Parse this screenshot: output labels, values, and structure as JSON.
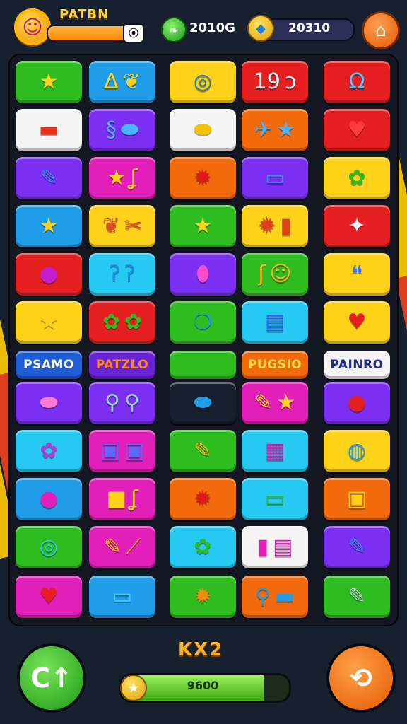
{
  "header": {
    "player_name": "PATBN",
    "xp_progress": 0.8,
    "xp_button": "⦿",
    "coins_value": "2010G",
    "gems_value": "20310",
    "icons": {
      "avatar": "face-avatar-icon",
      "coin": "leaf-coin-icon",
      "gem": "shield-gem-icon",
      "shop": "shop-icon"
    }
  },
  "colors": {
    "green": "#2ebd1f",
    "blue": "#1f9de8",
    "yellow": "#ffd21a",
    "red": "#e51f1f",
    "orange": "#f26a0c",
    "purple": "#7b2ff2",
    "magenta": "#e21fb8",
    "white": "#f4f4f4",
    "cyan": "#25c9f2"
  },
  "tiles": [
    {
      "bg": "#2ebd1f",
      "glyphs": [
        "★"
      ],
      "fg": "#ffd21a"
    },
    {
      "bg": "#1f9de8",
      "glyphs": [
        "ᐃ",
        "❦"
      ],
      "fg": "#ffd21a"
    },
    {
      "bg": "#ffd21a",
      "glyphs": [
        "◎"
      ],
      "fg": "#1e7fc2"
    },
    {
      "bg": "#e51f1f",
      "glyphs": [
        "19",
        "ↄ"
      ],
      "fg": "#ffffff"
    },
    {
      "bg": "#e51f1f",
      "glyphs": [
        "Ω"
      ],
      "fg": "#5ac8ff"
    },
    {
      "bg": "#f4f4f4",
      "glyphs": [
        "▬"
      ],
      "fg": "#e03018"
    },
    {
      "bg": "#7b2ff2",
      "glyphs": [
        "§",
        "⬬"
      ],
      "fg": "#4ab4ff"
    },
    {
      "bg": "#f4f4f4",
      "glyphs": [
        "⬬"
      ],
      "fg": "#f2c400"
    },
    {
      "bg": "#f26a0c",
      "glyphs": [
        "✈",
        "★"
      ],
      "fg": "#4ab4ff"
    },
    {
      "bg": "#e51f1f",
      "glyphs": [
        "♥"
      ],
      "fg": "#ff3a3a"
    },
    {
      "bg": "#7b2ff2",
      "glyphs": [
        "✎"
      ],
      "fg": "#3a8cff"
    },
    {
      "bg": "#e21fb8",
      "glyphs": [
        "★",
        "ʆ"
      ],
      "fg": "#ffd21a"
    },
    {
      "bg": "#f26a0c",
      "glyphs": [
        "✹"
      ],
      "fg": "#e01818"
    },
    {
      "bg": "#7b2ff2",
      "glyphs": [
        "▭"
      ],
      "fg": "#3a8cff"
    },
    {
      "bg": "#ffd21a",
      "glyphs": [
        "✿"
      ],
      "fg": "#2ebd1f"
    },
    {
      "bg": "#1f9de8",
      "glyphs": [
        "★"
      ],
      "fg": "#ffd21a"
    },
    {
      "bg": "#ffd21a",
      "glyphs": [
        "❦",
        "✂"
      ],
      "fg": "#e04a2a"
    },
    {
      "bg": "#2ebd1f",
      "glyphs": [
        "★"
      ],
      "fg": "#ffd21a"
    },
    {
      "bg": "#ffd21a",
      "glyphs": [
        "✹",
        "▮"
      ],
      "fg": "#e0401a"
    },
    {
      "bg": "#e51f1f",
      "glyphs": [
        "✦"
      ],
      "fg": "#e8f6ff"
    },
    {
      "bg": "#e51f1f",
      "glyphs": [
        "●"
      ],
      "fg": "#c21fd0"
    },
    {
      "bg": "#25c9f2",
      "glyphs": [
        "ʔ",
        "ʔ"
      ],
      "fg": "#1f8de0"
    },
    {
      "bg": "#7b2ff2",
      "glyphs": [
        "⬮"
      ],
      "fg": "#ff4ad0"
    },
    {
      "bg": "#2ebd1f",
      "glyphs": [
        "ʃ",
        "☺"
      ],
      "fg": "#ffb020"
    },
    {
      "bg": "#ffd21a",
      "glyphs": [
        "❝"
      ],
      "fg": "#3a6cf2"
    },
    {
      "bg": "#ffd21a",
      "glyphs": [
        "★"
      ],
      "fg": "#ffd21a"
    },
    {
      "bg": "#e51f1f",
      "glyphs": [
        "✿",
        "✿"
      ],
      "fg": "#2ebd1f"
    },
    {
      "bg": "#2ebd1f",
      "glyphs": [
        "❍"
      ],
      "fg": "#1f9de8"
    },
    {
      "bg": "#25c9f2",
      "glyphs": [
        "▤"
      ],
      "fg": "#3a5cf2"
    },
    {
      "bg": "#ffd21a",
      "glyphs": [
        "♥"
      ],
      "fg": "#e51f1f"
    },
    {
      "label": "PSAMO",
      "bg": "#1f5ed8",
      "fg": "#ffffff"
    },
    {
      "label": "PATZLO",
      "bg": "#6a24d8",
      "fg": "#ff8a1a"
    },
    {
      "label": "",
      "bg": "#2ebd1f",
      "fg": "#ffffff"
    },
    {
      "label": "PUGSIO",
      "bg": "#f26a0c",
      "fg": "#ffe04a"
    },
    {
      "label": "PAINRO",
      "bg": "#f4f4f4",
      "fg": "#1f2a8a"
    },
    {
      "bg": "#7b2ff2",
      "glyphs": [
        "⬬"
      ],
      "fg": "#ff7ad0"
    },
    {
      "bg": "#7b2ff2",
      "glyphs": [
        "⚲",
        "⚲"
      ],
      "fg": "#9ad6d0"
    },
    {
      "bg": "#17202e",
      "glyphs": [
        "⬬"
      ],
      "fg": "#1f9de8"
    },
    {
      "bg": "#e21fb8",
      "glyphs": [
        "✎",
        "★"
      ],
      "fg": "#ffd21a"
    },
    {
      "bg": "#7b2ff2",
      "glyphs": [
        "●"
      ],
      "fg": "#e51f1f"
    },
    {
      "bg": "#25c9f2",
      "glyphs": [
        "✿"
      ],
      "fg": "#b23ad8"
    },
    {
      "bg": "#e21fb8",
      "glyphs": [
        "▣",
        "▣"
      ],
      "fg": "#5a6aff"
    },
    {
      "bg": "#2ebd1f",
      "glyphs": [
        "✎"
      ],
      "fg": "#ffb020"
    },
    {
      "bg": "#25c9f2",
      "glyphs": [
        "▦"
      ],
      "fg": "#e21fb8"
    },
    {
      "bg": "#ffd21a",
      "glyphs": [
        "◍"
      ],
      "fg": "#1f9de8"
    },
    {
      "bg": "#1f9de8",
      "glyphs": [
        "●"
      ],
      "fg": "#e21fb8"
    },
    {
      "bg": "#e21fb8",
      "glyphs": [
        "■",
        "ʆ"
      ],
      "fg": "#ffd21a"
    },
    {
      "bg": "#f26a0c",
      "glyphs": [
        "✹"
      ],
      "fg": "#e01818"
    },
    {
      "bg": "#25c9f2",
      "glyphs": [
        "▭"
      ],
      "fg": "#2ebd1f"
    },
    {
      "bg": "#f26a0c",
      "glyphs": [
        "▣"
      ],
      "fg": "#ffd21a"
    },
    {
      "bg": "#2ebd1f",
      "glyphs": [
        "◎"
      ],
      "fg": "#25c9f2"
    },
    {
      "bg": "#e21fb8",
      "glyphs": [
        "✎",
        "⟋"
      ],
      "fg": "#ffb020"
    },
    {
      "bg": "#25c9f2",
      "glyphs": [
        "✿"
      ],
      "fg": "#2ebd1f"
    },
    {
      "bg": "#f4f4f4",
      "glyphs": [
        "▮",
        "▤"
      ],
      "fg": "#e21fb8"
    },
    {
      "bg": "#7b2ff2",
      "glyphs": [
        "✎"
      ],
      "fg": "#3a8cff"
    },
    {
      "bg": "#e21fb8",
      "glyphs": [
        "♥"
      ],
      "fg": "#e51f1f"
    },
    {
      "bg": "#1f9de8",
      "glyphs": [
        "▭"
      ],
      "fg": "#3ad0ff"
    },
    {
      "bg": "#2ebd1f",
      "glyphs": [
        "✹"
      ],
      "fg": "#f28a0c"
    },
    {
      "bg": "#f26a0c",
      "glyphs": [
        "⚲",
        "▬"
      ],
      "fg": "#1f9de8"
    },
    {
      "bg": "#2ebd1f",
      "glyphs": [
        "✎"
      ],
      "fg": "#c0c8d8"
    }
  ],
  "footer": {
    "multiplier": "KX2",
    "progress": 0.85,
    "progress_value": "9600",
    "left_button": "C↑",
    "right_button": "⟲",
    "icons": {
      "left": "refresh-arrow-icon",
      "right": "settings-swirl-icon",
      "progress": "star-icon"
    }
  }
}
